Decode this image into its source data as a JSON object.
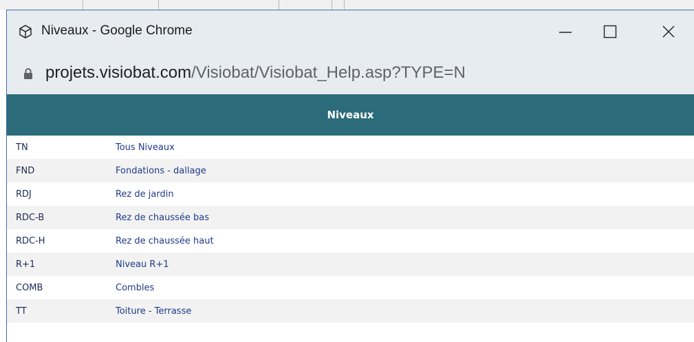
{
  "window": {
    "title": "Niveaux - Google Chrome",
    "app_icon": "chrome-app-icon",
    "controls": {
      "minimize_icon": "minimize-icon",
      "maximize_icon": "maximize-icon",
      "close_icon": "close-icon"
    }
  },
  "address_bar": {
    "lock_icon": "lock-icon",
    "domain": "projets.visiobat.com",
    "path": "/Visiobat/Visiobat_Help.asp?TYPE=N"
  },
  "page": {
    "title": "Niveaux",
    "header_color": "#2c6b7a",
    "rows": [
      {
        "code": "TN",
        "label": "Tous Niveaux"
      },
      {
        "code": "FND",
        "label": "Fondations - dallage"
      },
      {
        "code": "RDJ",
        "label": "Rez de jardin"
      },
      {
        "code": "RDC-B",
        "label": "Rez de chaussée bas"
      },
      {
        "code": "RDC-H",
        "label": "Rez de chaussée haut"
      },
      {
        "code": "R+1",
        "label": "Niveau R+1"
      },
      {
        "code": "COMB",
        "label": "Combles"
      },
      {
        "code": "TT",
        "label": "Toiture - Terrasse"
      }
    ]
  }
}
